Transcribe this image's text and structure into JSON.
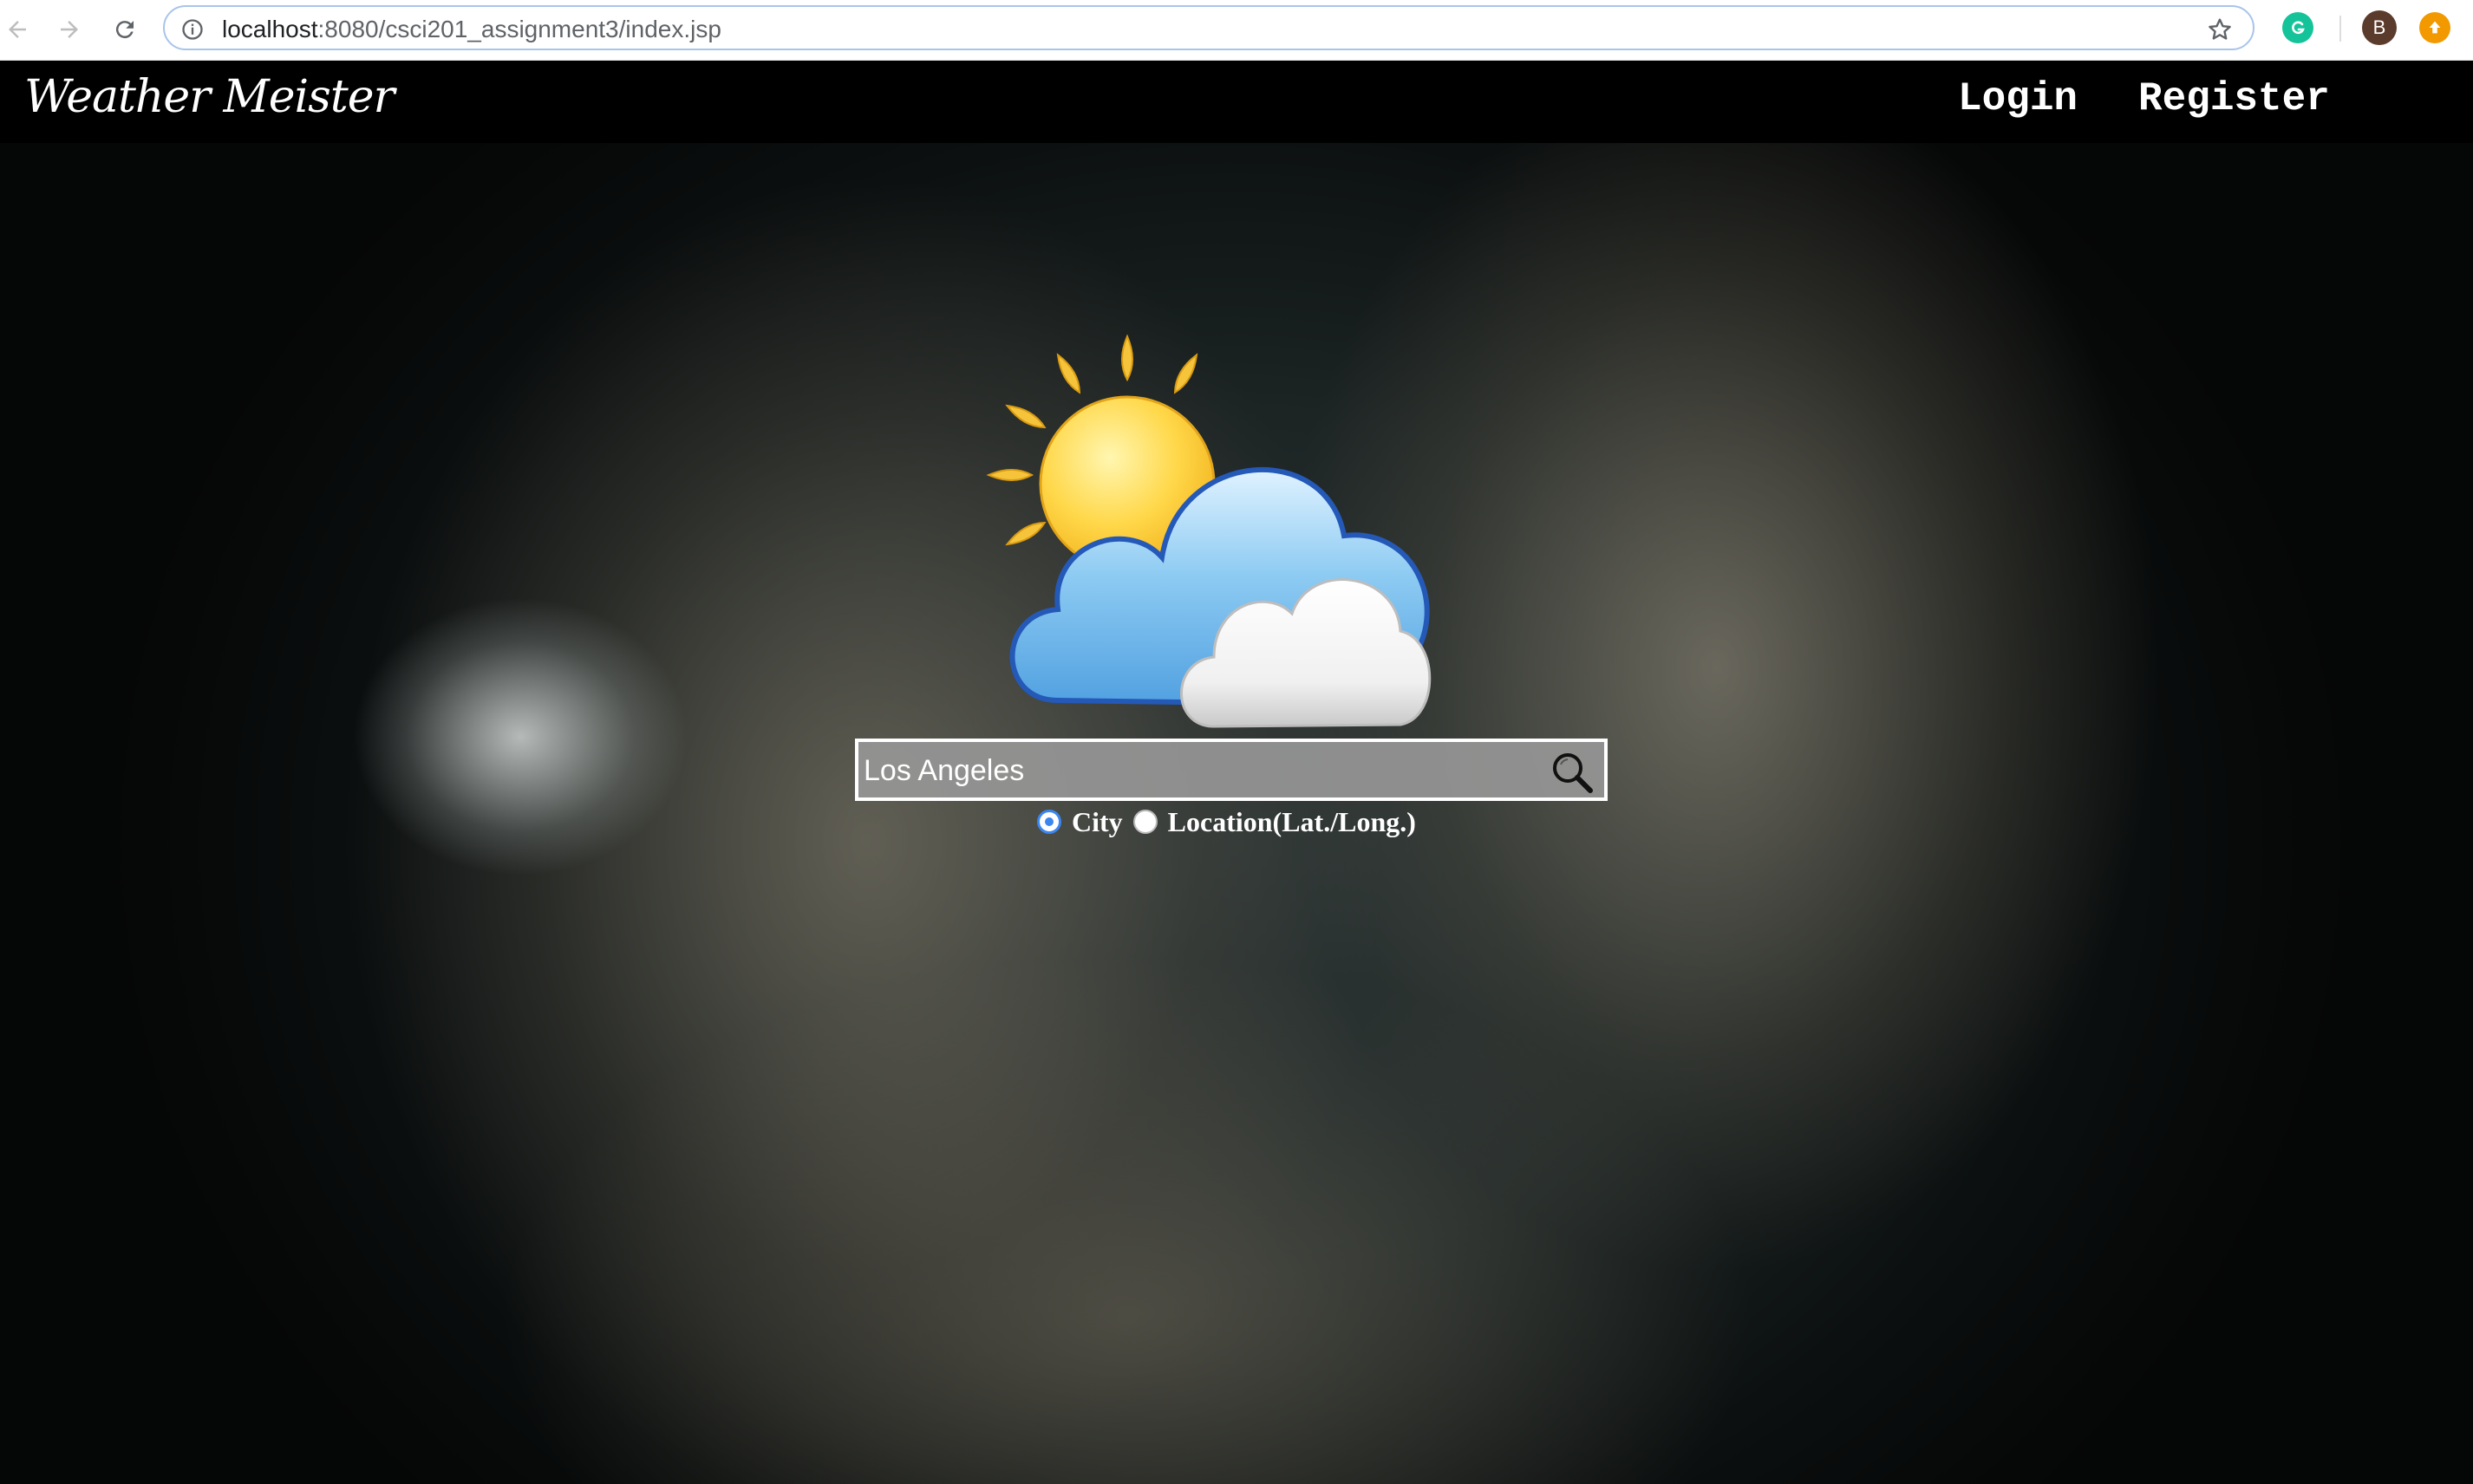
{
  "browser": {
    "url_host": "localhost",
    "url_rest": ":8080/csci201_assignment3/index.jsp",
    "avatar_initial": "B"
  },
  "site": {
    "logo": "Weather Meister",
    "nav": {
      "login": "Login",
      "register": "Register"
    }
  },
  "search": {
    "value": "Los Angeles",
    "options": [
      {
        "label": "City",
        "checked": true
      },
      {
        "label": "Location(Lat./Long.)",
        "checked": false
      }
    ]
  },
  "colors": {
    "topbar": "#000000",
    "radio_accent": "#3b87f0",
    "text": "#ffffff"
  },
  "icons": [
    "back-arrow-icon",
    "forward-arrow-icon",
    "reload-icon",
    "info-icon",
    "star-icon",
    "grammarly-icon",
    "extension-update-icon",
    "search-icon",
    "weather-sun-cloud-icon"
  ]
}
